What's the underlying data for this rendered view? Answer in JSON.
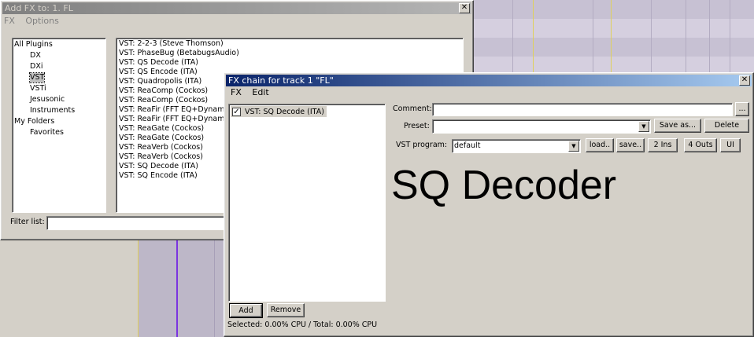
{
  "add_fx_window": {
    "title": "Add FX to: 1. FL",
    "close_glyph": "✕",
    "menu": [
      "FX",
      "Options"
    ],
    "tree": [
      {
        "label": "All Plugins",
        "indent": 0
      },
      {
        "label": "DX",
        "indent": 1
      },
      {
        "label": "DXi",
        "indent": 1
      },
      {
        "label": "VST",
        "indent": 1,
        "selected": true
      },
      {
        "label": "VSTi",
        "indent": 1
      },
      {
        "label": "Jesusonic",
        "indent": 1
      },
      {
        "label": "Instruments",
        "indent": 1
      },
      {
        "label": "My Folders",
        "indent": 0
      },
      {
        "label": "Favorites",
        "indent": 1
      }
    ],
    "plugins": [
      "VST: 2-2-3 (Steve Thomson)",
      "VST: PhaseBug (BetabugsAudio)",
      "VST: QS Decode (ITA)",
      "VST: QS Encode (ITA)",
      "VST: Quadropolis (ITA)",
      "VST: ReaComp (Cockos)",
      "VST: ReaComp (Cockos)",
      "VST: ReaFir (FFT EQ+Dynam",
      "VST: ReaFir (FFT EQ+Dynam",
      "VST: ReaGate (Cockos)",
      "VST: ReaGate (Cockos)",
      "VST: ReaVerb (Cockos)",
      "VST: ReaVerb (Cockos)",
      "VST: SQ Decode (ITA)",
      "VST: SQ Encode (ITA)"
    ],
    "filter_label": "Filter list:",
    "filter_value": ""
  },
  "fx_chain_window": {
    "title": "FX chain for track 1 \"FL\"",
    "close_glyph": "✕",
    "menu": [
      "FX",
      "Edit"
    ],
    "chain_items": [
      {
        "label": "VST: SQ Decode (ITA)",
        "checked": true
      }
    ],
    "check_glyph": "✓",
    "add_label": "Add",
    "remove_label": "Remove",
    "status": "Selected: 0.00% CPU / Total: 0.00% CPU",
    "comment_label": "Comment:",
    "comment_value": "",
    "comment_btn": "...",
    "preset_label": "Preset:",
    "preset_value": "",
    "save_as_label": "Save as...",
    "delete_label": "Delete",
    "vst_program_label": "VST program:",
    "vst_program_value": "default",
    "load_label": "load..",
    "save_label": "save..",
    "ins_label": "2 Ins",
    "outs_label": "4 Outs",
    "ui_label": "UI",
    "combo_arrow": "▼",
    "plugin_display": "SQ Decoder"
  },
  "colors": {
    "window_bg": "#d4d0c8",
    "active_title": "#0a246a",
    "inactive_title": "#808080",
    "track_bg": "#c7c1d3",
    "cursor_purple": "#7b34e0",
    "marker_yellow": "#e0d05a"
  }
}
